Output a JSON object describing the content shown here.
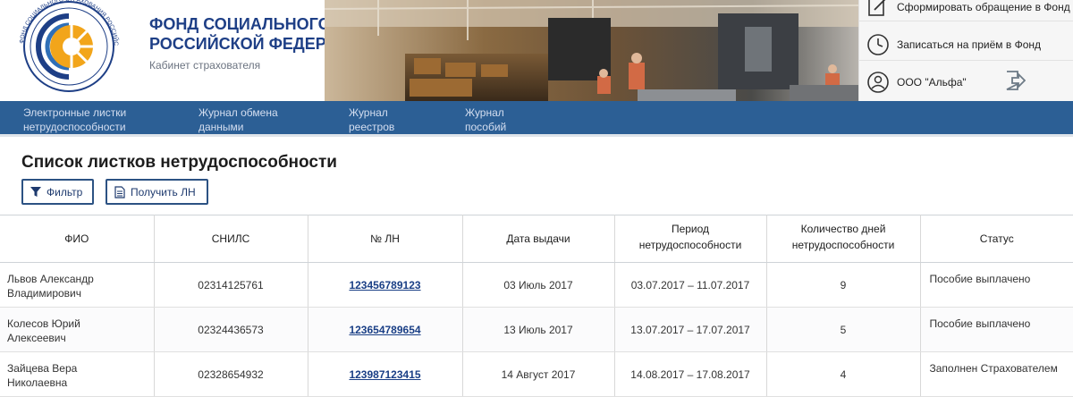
{
  "header": {
    "org_line1": "ФОНД СОЦИАЛЬНОГО СТРАХОВАНИЯ",
    "org_line2": "РОССИЙСКОЙ ФЕДЕРАЦИИ",
    "cabinet": "Кабинет страхователя",
    "logo_arc_text": "ФОНД СОЦИАЛЬНОГО СТРАХОВАНИЯ РОССИЙСКОЙ ФЕДЕРАЦИИ"
  },
  "right_panel": {
    "compose_appeal": "Сформировать обращение в Фонд",
    "book_appointment": "Записаться на приём в Фонд",
    "company": "ООО \"Альфа\""
  },
  "nav": {
    "items": [
      {
        "line1": "Электронные листки",
        "line2": "нетрудоспособности"
      },
      {
        "line1": "Журнал обмена",
        "line2": "данными"
      },
      {
        "line1": "Журнал",
        "line2": "реестров"
      },
      {
        "line1": "Журнал",
        "line2": "пособий"
      }
    ]
  },
  "main": {
    "title": "Список листков нетрудоспособности",
    "filter_button": "Фильтр",
    "get_ln_button": "Получить ЛН"
  },
  "table": {
    "headers": {
      "fio": "ФИО",
      "snils": "СНИЛС",
      "ln": "№ ЛН",
      "date": "Дата выдачи",
      "period_line1": "Период",
      "period_line2": "нетрудоспособности",
      "days_line1": "Количество дней",
      "days_line2": "нетрудоспособности",
      "status": "Статус"
    },
    "rows": [
      {
        "fio_line1": "Львов Александр",
        "fio_line2": "Владимирович",
        "snils": "02314125761",
        "ln": "123456789123",
        "date": "03 Июль 2017",
        "period": "03.07.2017 – 11.07.2017",
        "days": "9",
        "status": "Пособие выплачено"
      },
      {
        "fio_line1": "Колесов Юрий",
        "fio_line2": "Алексеевич",
        "snils": "02324436573",
        "ln": "123654789654",
        "date": "13 Июль 2017",
        "period": "13.07.2017 – 17.07.2017",
        "days": "5",
        "status": "Пособие выплачено"
      },
      {
        "fio_line1": "Зайцева Вера",
        "fio_line2": "Николаевна",
        "snils": "02328654932",
        "ln": "123987123415",
        "date": "14 Август 2017",
        "period": "14.08.2017 – 17.08.2017",
        "days": "4",
        "status": "Заполнен Страхователем"
      }
    ]
  },
  "colors": {
    "nav_bg": "#2c5f95",
    "brand_blue": "#1e3f86",
    "logo_orange": "#f2a51a",
    "link": "#1a3f86"
  },
  "icons": {
    "compose": "compose-icon",
    "clock": "clock-icon",
    "user": "user-icon",
    "logout": "logout-icon",
    "filter": "filter-icon",
    "document": "document-icon"
  }
}
